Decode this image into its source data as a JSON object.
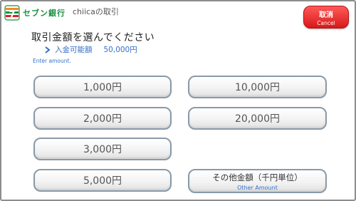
{
  "header": {
    "brand": "セブン銀行",
    "screen_title": "chiicaの取引",
    "cancel_label": "取消",
    "cancel_sub": "Cancel"
  },
  "prompt": {
    "title": "取引金額を選んでください",
    "balance_label": "入金可能額",
    "balance_value": "50,000円",
    "subtitle_en": "Enter amount."
  },
  "amounts": {
    "a1000": "1,000円",
    "a2000": "2,000円",
    "a3000": "3,000円",
    "a5000": "5,000円",
    "a10000": "10,000円",
    "a20000": "20,000円",
    "other": "その他金額（千円単位）",
    "other_en": "Other Amount"
  },
  "colors": {
    "accent_blue": "#3470c9",
    "cancel_red": "#d81818",
    "brand_green": "#1a8f3f"
  }
}
